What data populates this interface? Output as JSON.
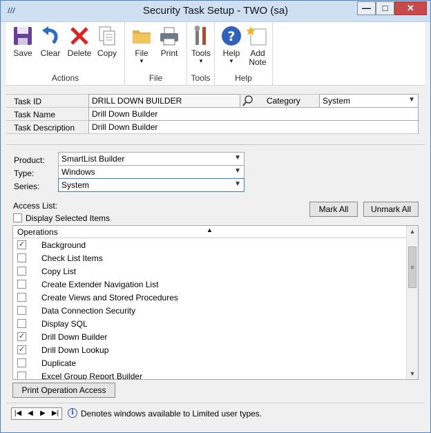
{
  "window": {
    "title": "Security Task Setup  -  TWO (sa)",
    "controls": {
      "minimize": "—",
      "maximize": "□",
      "close": "✕"
    }
  },
  "ribbon": {
    "groups": [
      {
        "label": "Actions",
        "buttons": [
          {
            "label": "Save",
            "icon": "save-icon"
          },
          {
            "label": "Clear",
            "icon": "undo-icon"
          },
          {
            "label": "Delete",
            "icon": "delete-icon"
          },
          {
            "label": "Copy",
            "icon": "copy-icon"
          }
        ]
      },
      {
        "label": "File",
        "buttons": [
          {
            "label": "File",
            "icon": "folder-icon"
          },
          {
            "label": "Print",
            "icon": "printer-icon"
          }
        ]
      },
      {
        "label": "Tools",
        "buttons": [
          {
            "label": "Tools",
            "icon": "tools-icon"
          }
        ]
      },
      {
        "label": "Help",
        "buttons": [
          {
            "label": "Help",
            "icon": "help-icon"
          },
          {
            "label": "Add\nNote",
            "label_line1": "Add",
            "label_line2": "Note",
            "icon": "note-icon"
          }
        ]
      }
    ]
  },
  "task": {
    "id_label": "Task ID",
    "id_value": "DRILL DOWN BUILDER",
    "category_label": "Category",
    "category_value": "System",
    "name_label": "Task Name",
    "name_value": "Drill Down Builder",
    "description_label": "Task Description",
    "description_value": "Drill Down Builder"
  },
  "filters": {
    "product_label": "Product:",
    "product_value": "SmartList Builder",
    "type_label": "Type:",
    "type_value": "Windows",
    "series_label": "Series:",
    "series_value": "System"
  },
  "access": {
    "list_label": "Access List:",
    "display_selected_label": "Display Selected Items",
    "mark_all": "Mark All",
    "unmark_all": "Unmark All",
    "column_header": "Operations",
    "operations": [
      {
        "name": "Background",
        "checked": true
      },
      {
        "name": "Check List Items",
        "checked": false
      },
      {
        "name": "Copy List",
        "checked": false
      },
      {
        "name": "Create Extender Navigation List",
        "checked": false
      },
      {
        "name": "Create Views and Stored Procedures",
        "checked": false
      },
      {
        "name": "Data Connection Security",
        "checked": false
      },
      {
        "name": "Display SQL",
        "checked": false
      },
      {
        "name": "Drill Down Builder",
        "checked": true
      },
      {
        "name": "Drill Down Lookup",
        "checked": true
      },
      {
        "name": "Duplicate",
        "checked": false
      },
      {
        "name": "Excel Group Report Builder",
        "checked": false
      }
    ]
  },
  "print_button": "Print Operation Access",
  "status": {
    "text": "Denotes windows available to Limited user types."
  }
}
